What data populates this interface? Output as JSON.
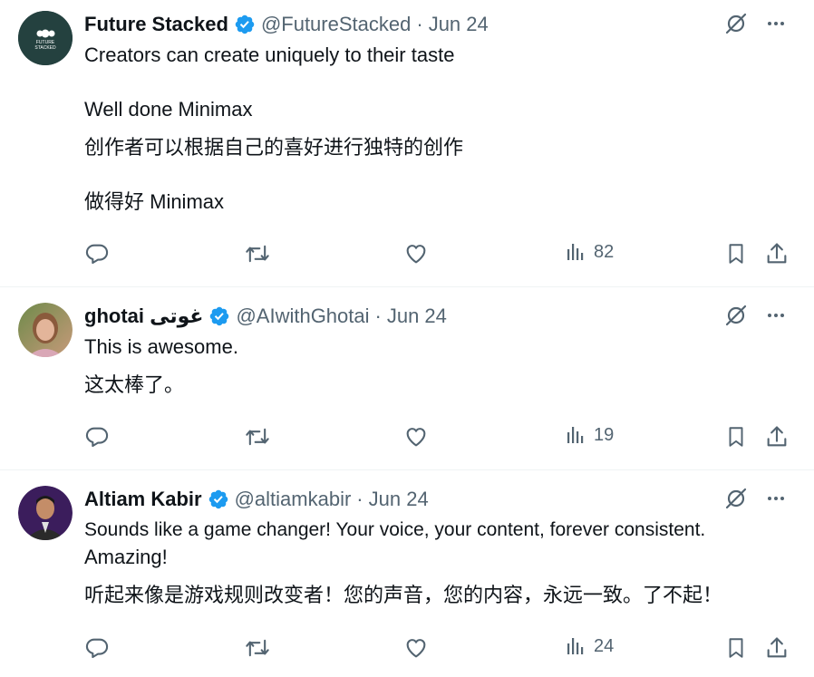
{
  "colors": {
    "verified": "#1d9bf0",
    "muted": "#536471",
    "text": "#0f1419"
  },
  "tweets": [
    {
      "name": "Future Stacked",
      "handle": "@FutureStacked",
      "dot": "·",
      "date": "Jun 24",
      "avatar_text": "FUTURE STACKED",
      "lines": [
        "Creators can create uniquely to their taste",
        "Well done Minimax",
        "创作者可以根据自己的喜好进行独特的创作",
        "做得好 Minimax"
      ],
      "views": "82"
    },
    {
      "name": "ghotai غوتی",
      "handle": "@AIwithGhotai",
      "dot": "·",
      "date": "Jun 24",
      "lines": [
        "This is awesome.",
        "这太棒了。"
      ],
      "views": "19"
    },
    {
      "name": "Altiam Kabir",
      "handle": "@altiamkabir",
      "dot": "·",
      "date": "Jun 24",
      "lines": [
        "Sounds like a game changer! Your voice, your content, forever consistent.",
        "Amazing!",
        "听起来像是游戏规则改变者！您的声音，您的内容，永远一致。了不起！"
      ],
      "views": "24"
    }
  ]
}
